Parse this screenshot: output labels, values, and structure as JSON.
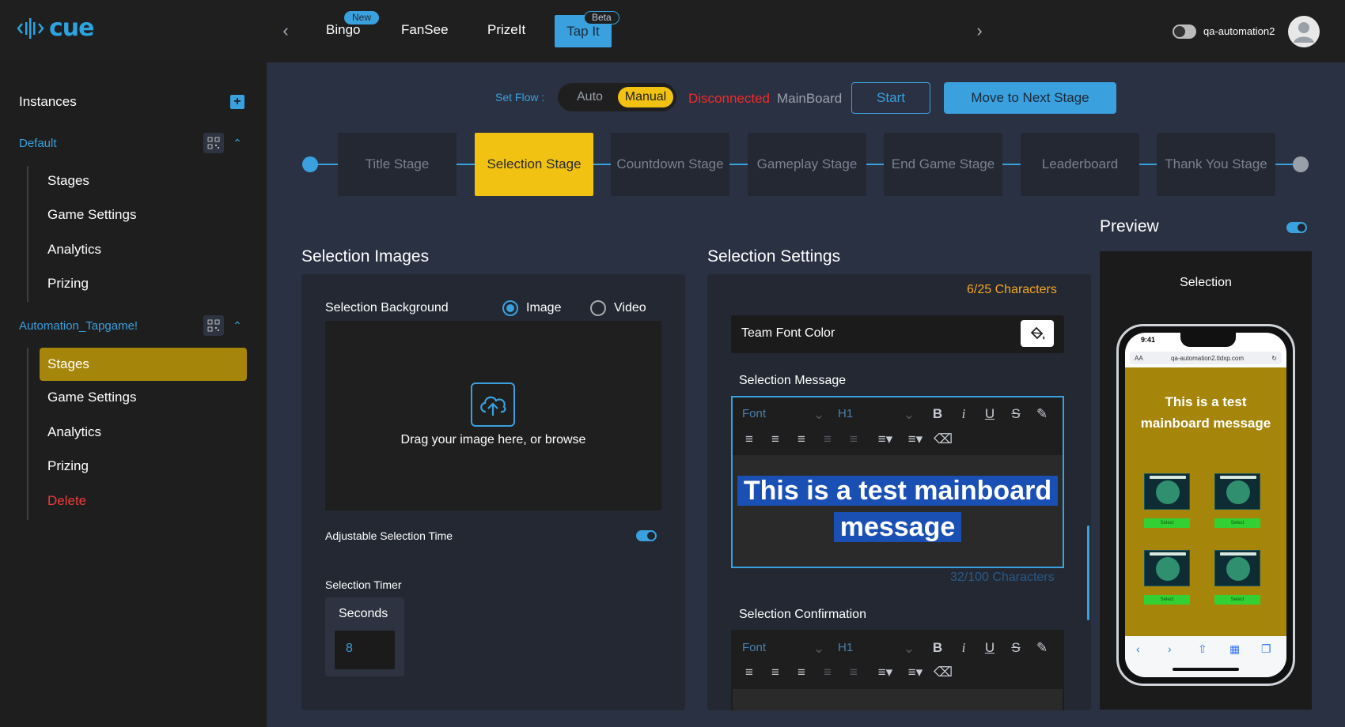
{
  "header": {
    "logo_text": "cue",
    "nav_tabs": [
      {
        "label": "Bingo",
        "badge": "New"
      },
      {
        "label": "FanSee"
      },
      {
        "label": "PrizeIt"
      },
      {
        "label": "Tap It",
        "badge": "Beta",
        "active": true
      }
    ],
    "username": "qa-automation2"
  },
  "sidebar": {
    "title": "Instances",
    "groups": [
      {
        "name": "Default",
        "items": [
          "Stages",
          "Game Settings",
          "Analytics",
          "Prizing"
        ]
      },
      {
        "name": "Automation_Tapgame!",
        "items": [
          "Stages",
          "Game Settings",
          "Analytics",
          "Prizing",
          "Delete"
        ],
        "active_item": "Stages"
      }
    ]
  },
  "flow": {
    "set_flow_label": "Set Flow :",
    "auto_label": "Auto",
    "manual_label": "Manual",
    "status": "Disconnected",
    "board": "MainBoard",
    "start_label": "Start",
    "next_label": "Move to Next Stage"
  },
  "stages": [
    "Title Stage",
    "Selection Stage",
    "Countdown Stage",
    "Gameplay Stage",
    "End Game Stage",
    "Leaderboard",
    "Thank You Stage"
  ],
  "active_stage": "Selection Stage",
  "selection_images": {
    "title": "Selection Images",
    "background_label": "Selection Background",
    "image_option": "Image",
    "video_option": "Video",
    "selected_option": "Image",
    "drop_text": "Drag your image here, or browse",
    "adjustable_label": "Adjustable Selection Time",
    "adjustable_on": true,
    "timer_label": "Selection Timer",
    "seconds_label": "Seconds",
    "seconds_value": "8"
  },
  "selection_settings": {
    "title": "Selection Settings",
    "top_count": "6/25 Characters",
    "team_font_color_label": "Team Font Color",
    "message_label": "Selection Message",
    "toolbar_font": "Font",
    "toolbar_heading": "H1",
    "message_text": "This is a test mainboard message",
    "message_line1": "This is a test mainboard",
    "message_line2": "message",
    "message_count": "32/100 Characters",
    "confirmation_label": "Selection Confirmation"
  },
  "preview": {
    "title": "Preview",
    "toggle_on": true,
    "stage_label": "Selection",
    "phone_time": "9:41",
    "phone_url": "qa-automation2.tldxp.com",
    "phone_url_prefix": "AA",
    "phone_message": "This is a test mainboard message",
    "select_label": "Select"
  },
  "colors": {
    "accent": "#3aa0de",
    "stage_active": "#f1c211",
    "sidebar_active": "#a5860a",
    "danger": "#ef3b3b"
  }
}
